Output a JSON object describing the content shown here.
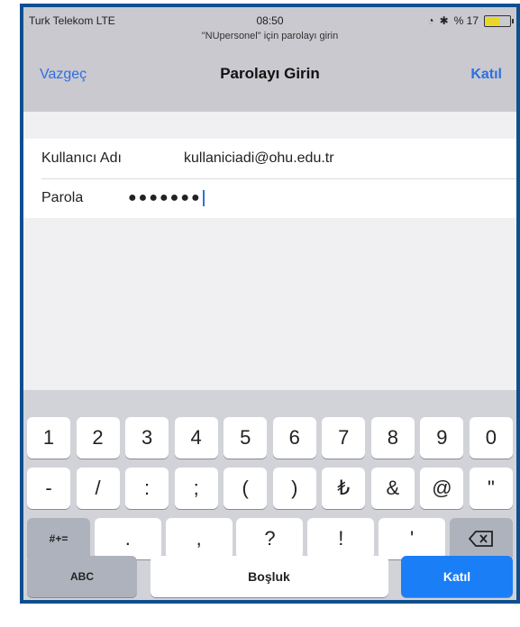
{
  "status_bar": {
    "carrier": "Turk Telekom  LTE",
    "time": "08:50",
    "battery_text": "% 17",
    "battery_level_percent": 17
  },
  "header": {
    "subtitle": "\"NUpersonel\" için parolayı girin",
    "cancel_label": "Vazgeç",
    "title": "Parolayı Girin",
    "join_label": "Katıl"
  },
  "form": {
    "username_label": "Kullanıcı Adı",
    "username_value": "kullaniciadi@ohu.edu.tr",
    "password_label": "Parola",
    "password_value": "●●●●●●●"
  },
  "keyboard": {
    "row1": [
      "1",
      "2",
      "3",
      "4",
      "5",
      "6",
      "7",
      "8",
      "9",
      "0"
    ],
    "row2": [
      "-",
      "/",
      ":",
      ";",
      "(",
      ")",
      "₺",
      "&",
      "@",
      "\""
    ],
    "row3_shift": "#+=",
    "row3": [
      ".",
      ",",
      "?",
      "!",
      "'"
    ],
    "backspace_icon": "backspace-icon",
    "abc_label": "ABC",
    "space_label": "Boşluk",
    "return_label": "Katıl"
  }
}
